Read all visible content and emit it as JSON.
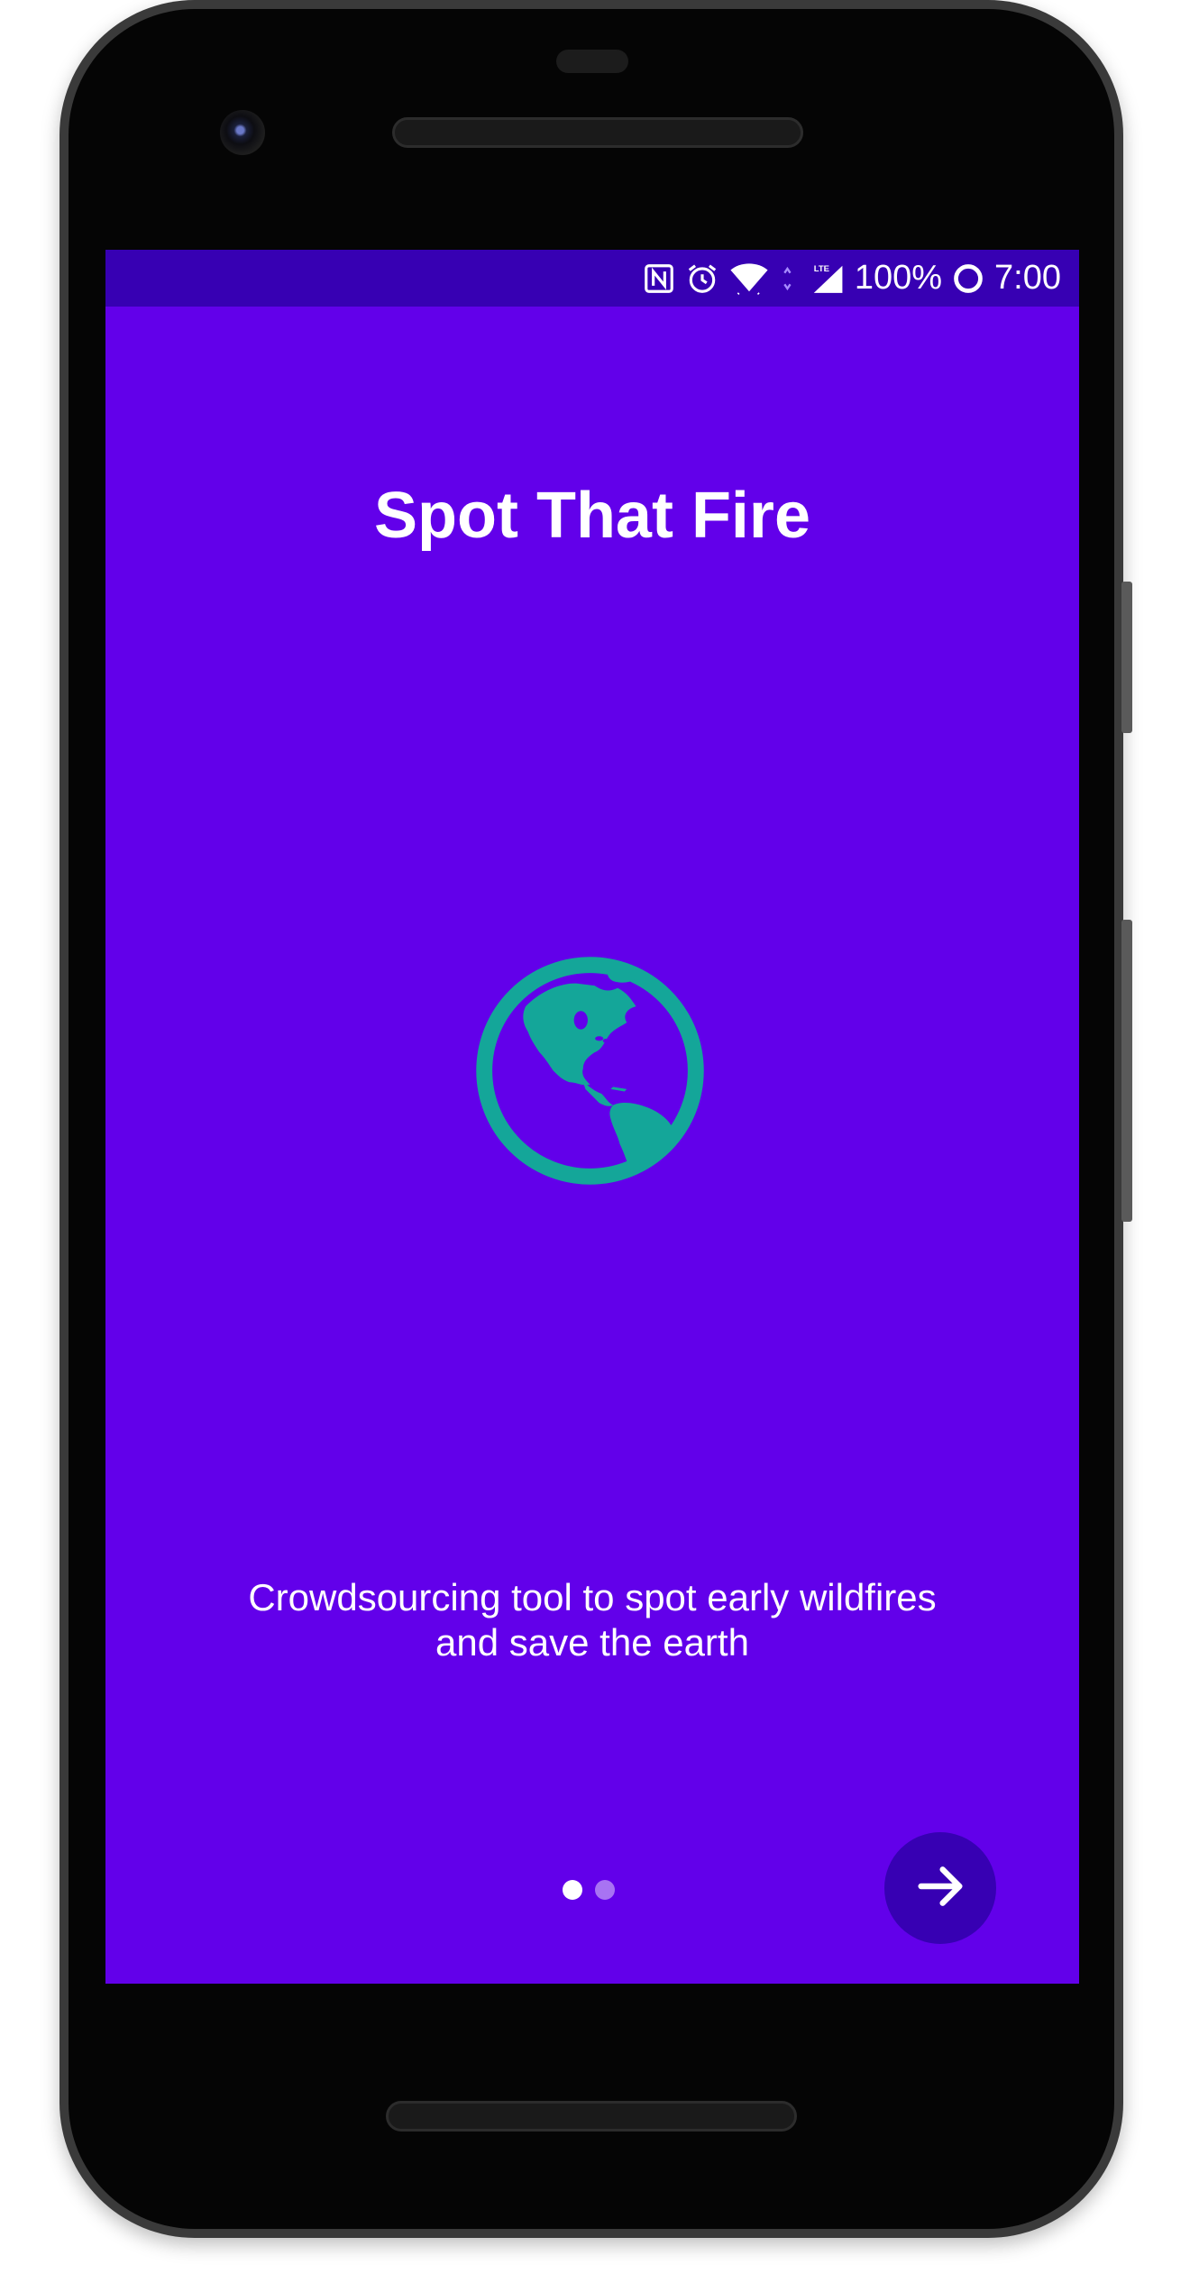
{
  "status_bar": {
    "battery_percent": "100%",
    "time": "7:00",
    "icons": [
      "nfc-icon",
      "alarm-icon",
      "wifi-icon",
      "lte-icon",
      "signal-icon",
      "battery-icon"
    ],
    "lte_label": "LTE",
    "color": "#3700b3"
  },
  "onboarding": {
    "title": "Spot That Fire",
    "illustration_icon": "globe-icon",
    "description_line1": "Crowdsourcing tool to spot early wildfires",
    "description_line2": "and save the earth",
    "page_count": 2,
    "current_page": 1,
    "next_button_icon": "arrow-right-icon"
  },
  "colors": {
    "background": "#6200ea",
    "accent": "#3700b3",
    "globe": "#14a699",
    "text": "#ffffff"
  }
}
